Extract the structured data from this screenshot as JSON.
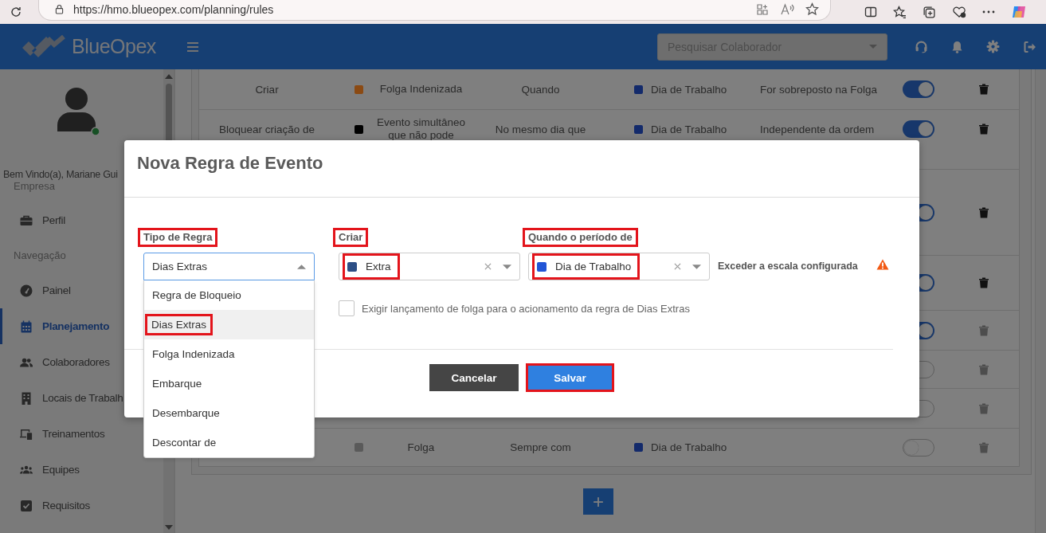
{
  "browser": {
    "url": "https://hmo.blueopex.com/planning/rules"
  },
  "header": {
    "logo": "BlueOpex",
    "search_placeholder": "Pesquisar Colaborador"
  },
  "sidebar": {
    "greeting": "Bem Vindo(a), Mariane Gui",
    "online": true,
    "sections": [
      {
        "title": "Empresa",
        "items": [
          {
            "label": "Perfil",
            "selected": false
          }
        ]
      },
      {
        "title": "Navegação",
        "items": [
          {
            "label": "Painel",
            "selected": false
          },
          {
            "label": "Planejamento",
            "selected": true
          },
          {
            "label": "Colaboradores",
            "selected": false
          },
          {
            "label": "Locais de Trabalh",
            "selected": false
          },
          {
            "label": "Treinamentos",
            "selected": false
          },
          {
            "label": "Equipes",
            "selected": false
          },
          {
            "label": "Requisitos",
            "selected": false
          }
        ]
      }
    ]
  },
  "rules_table": {
    "rows": [
      {
        "action": "Criar",
        "event": {
          "label": "Folga Indenizada",
          "color": "#8b4a13"
        },
        "condition": "Quando",
        "target": {
          "label": "Dia de Trabalho",
          "color": "#132a6b"
        },
        "detail": "For sobreposto na Folga",
        "enabled": true,
        "delete_disabled": false
      },
      {
        "action": "Bloquear criação de",
        "event": {
          "label": "Evento simultâneo que não pode",
          "color": "#000000"
        },
        "condition": "No mesmo dia que",
        "target": {
          "label": "Dia de Trabalho",
          "color": "#132a6b"
        },
        "detail": "Independente da ordem",
        "enabled": true,
        "delete_disabled": false
      },
      {
        "enabled": true,
        "delete_disabled": false
      },
      {
        "enabled": true,
        "delete_disabled": false
      },
      {
        "enabled": true,
        "delete_disabled": true
      },
      {
        "enabled": false,
        "delete_disabled": true
      },
      {
        "enabled": false,
        "delete_disabled": true
      },
      {
        "event": {
          "label": "Folga",
          "color": "#5a5a5a"
        },
        "condition": "Sempre com",
        "target": {
          "label": "Dia de Trabalho",
          "color": "#132a6b"
        },
        "enabled": false,
        "delete_disabled": true
      }
    ]
  },
  "add_button": "+",
  "modal": {
    "title": "Nova Regra de Evento",
    "fields": [
      {
        "label": "Tipo de Regra",
        "highlighted": true,
        "kind": "plain",
        "value": "Dias Extras",
        "value_highlighted": false,
        "open": true,
        "clearable": false
      },
      {
        "label": "Criar",
        "highlighted": true,
        "kind": "colored",
        "color": "#2d4f86",
        "value": "Extra",
        "value_highlighted": true,
        "open": false,
        "clearable": true
      },
      {
        "label": "Quando o período de",
        "highlighted": true,
        "kind": "colored",
        "color": "#2255d6",
        "value": "Dia de Trabalho",
        "value_highlighted": true,
        "open": false,
        "clearable": true
      }
    ],
    "note": "Exceder a escala configurada",
    "warning": true,
    "options": [
      {
        "label": "Regra de Bloqueio",
        "selected": false,
        "highlighted": false
      },
      {
        "label": "Dias Extras",
        "selected": true,
        "highlighted": true
      },
      {
        "label": "Folga Indenizada",
        "selected": false,
        "highlighted": false
      },
      {
        "label": "Embarque",
        "selected": false,
        "highlighted": false
      },
      {
        "label": "Desembarque",
        "selected": false,
        "highlighted": false
      },
      {
        "label": "Descontar de",
        "selected": false,
        "highlighted": false
      }
    ],
    "checkbox": {
      "label": "Exigir lançamento de folga para o acionamento da regra de Dias Extras",
      "checked": false
    },
    "buttons": [
      {
        "label": "Cancelar",
        "kind": "secondary",
        "highlighted": false
      },
      {
        "label": "Salvar",
        "kind": "primary",
        "highlighted": true
      }
    ]
  }
}
